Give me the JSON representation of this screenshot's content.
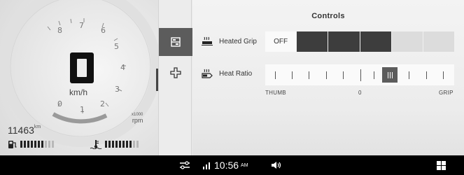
{
  "dashboard": {
    "speed": "0",
    "speed_unit": "km/h",
    "tach_numbers": [
      "0",
      "1",
      "2",
      "3",
      "4",
      "5",
      "6",
      "7",
      "8"
    ],
    "rpm_unit_top": "x1000",
    "rpm_unit": "rpm",
    "odometer_value": "11463",
    "odometer_unit": "km",
    "fuel_level_bars": 7,
    "fuel_total_bars": 10,
    "temp_level_bars": 8,
    "temp_total_bars": 10
  },
  "sidenav": {
    "items": [
      {
        "name": "controls-icon",
        "active": true
      },
      {
        "name": "plus-icon",
        "active": false
      }
    ]
  },
  "controls": {
    "title": "Controls",
    "heated_grip": {
      "label": "Heated Grip",
      "value_label": "OFF",
      "segments": [
        "dark",
        "dark",
        "dark",
        "light",
        "light"
      ]
    },
    "heat_ratio": {
      "label": "Heat Ratio",
      "left_label": "THUMB",
      "center_label": "0",
      "right_label": "GRIP",
      "position": 2,
      "range": [
        -5,
        5
      ]
    }
  },
  "bottombar": {
    "time": "10:56",
    "ampm": "AM"
  },
  "colors": {
    "accent_dark": "#3d3d3d",
    "active_nav": "#5c5c5c",
    "bottom_bar": "#000000"
  }
}
